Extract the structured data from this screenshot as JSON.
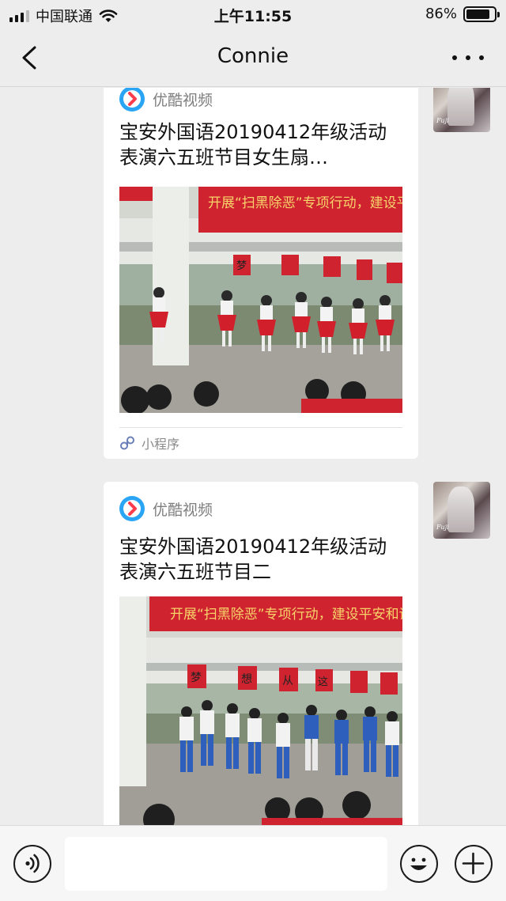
{
  "status_bar": {
    "carrier": "中国联通",
    "time": "上午11:55",
    "battery_percent_label": "86%",
    "battery_level": 0.86
  },
  "header": {
    "title": "Connie",
    "back_icon": "chevron-left-icon",
    "more_icon": "more-dots-icon"
  },
  "messages": [
    {
      "source": "优酷视频",
      "title": "宝安外国语20190412年级活动表演六五班节目女生扇…",
      "footer_label": "小程序",
      "photo_banner": "开展“扫黑除恶”专项行动，建设平",
      "photo_signs": [
        "梦",
        "",
        "",
        "",
        "",
        "",
        ""
      ]
    },
    {
      "source": "优酷视频",
      "title": "宝安外国语20190412年级活动表演六五班节目二",
      "photo_banner": "开展“扫黑除恶”专项行动，建设平安和谐",
      "photo_signs": [
        "梦",
        "想",
        "从",
        "这",
        "",
        ""
      ]
    }
  ],
  "input_bar": {
    "voice_icon": "voice-icon",
    "emoji_icon": "emoji-icon",
    "add_icon": "plus-icon",
    "input_value": ""
  },
  "colors": {
    "background": "#ededed",
    "card": "#ffffff",
    "youku_blue": "#2aa5f5",
    "youku_red": "#ff3c4c",
    "banner_red": "#c8202c"
  }
}
